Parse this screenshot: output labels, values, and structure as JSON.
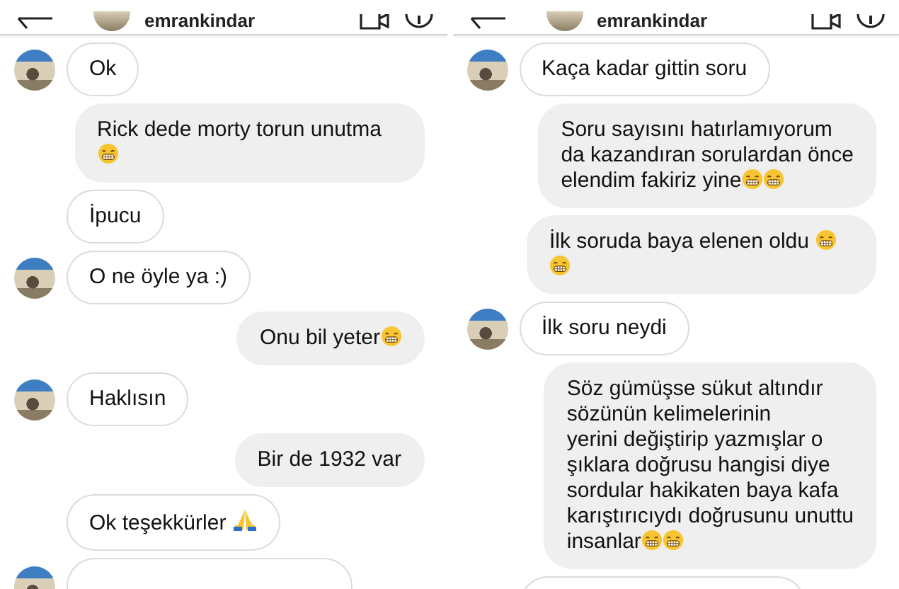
{
  "panels": [
    {
      "header": {
        "username": "emrankindar"
      },
      "messages": [
        {
          "kind": "incoming",
          "avatar": true,
          "text": "Ok"
        },
        {
          "kind": "outgoing",
          "text": "Rick dede morty torun unutma",
          "emoji": [
            {
              "kind": "grin"
            }
          ]
        },
        {
          "kind": "incoming",
          "avatar": false,
          "text": "İpucu"
        },
        {
          "kind": "incoming",
          "avatar": true,
          "text": "O ne öyle ya :)"
        },
        {
          "kind": "outgoing",
          "text": "Onu bil yeter",
          "emoji": [
            {
              "kind": "grin"
            }
          ]
        },
        {
          "kind": "incoming",
          "avatar": true,
          "text": "Haklısın"
        },
        {
          "kind": "outgoing",
          "text": "Bir de 1932 var"
        },
        {
          "kind": "incoming",
          "avatar": false,
          "text": "Ok teşekkürler ",
          "emoji": [
            {
              "kind": "pray"
            }
          ]
        },
        {
          "kind": "incoming-cut",
          "avatar": true
        }
      ]
    },
    {
      "header": {
        "username": "emrankindar"
      },
      "messages": [
        {
          "kind": "incoming",
          "avatar": true,
          "text": "Kaça kadar gittin soru"
        },
        {
          "kind": "outgoing",
          "text": "Soru sayısını hatırlamıyorum\nda kazandıran sorulardan önce\nelendim fakiriz yine",
          "emoji": [
            {
              "kind": "grin"
            },
            {
              "kind": "grin"
            }
          ]
        },
        {
          "kind": "outgoing",
          "text": "İlk soruda baya elenen oldu ",
          "emoji": [
            {
              "kind": "grin"
            },
            {
              "kind": "grin"
            }
          ]
        },
        {
          "kind": "incoming",
          "avatar": true,
          "text": "İlk soru neydi"
        },
        {
          "kind": "outgoing",
          "text": "Söz gümüşse sükut altındır\nsözünün kelimelerinin\nyerini değiştirip yazmışlar o\nşıklara doğrusu hangisi diye\nsordular hakikaten baya kafa\nkarıştırıcıydı  doğrusunu unuttu\ninsanlar",
          "emoji": [
            {
              "kind": "grin"
            },
            {
              "kind": "grin"
            }
          ]
        },
        {
          "kind": "incoming-cut",
          "avatar": false
        }
      ]
    }
  ]
}
